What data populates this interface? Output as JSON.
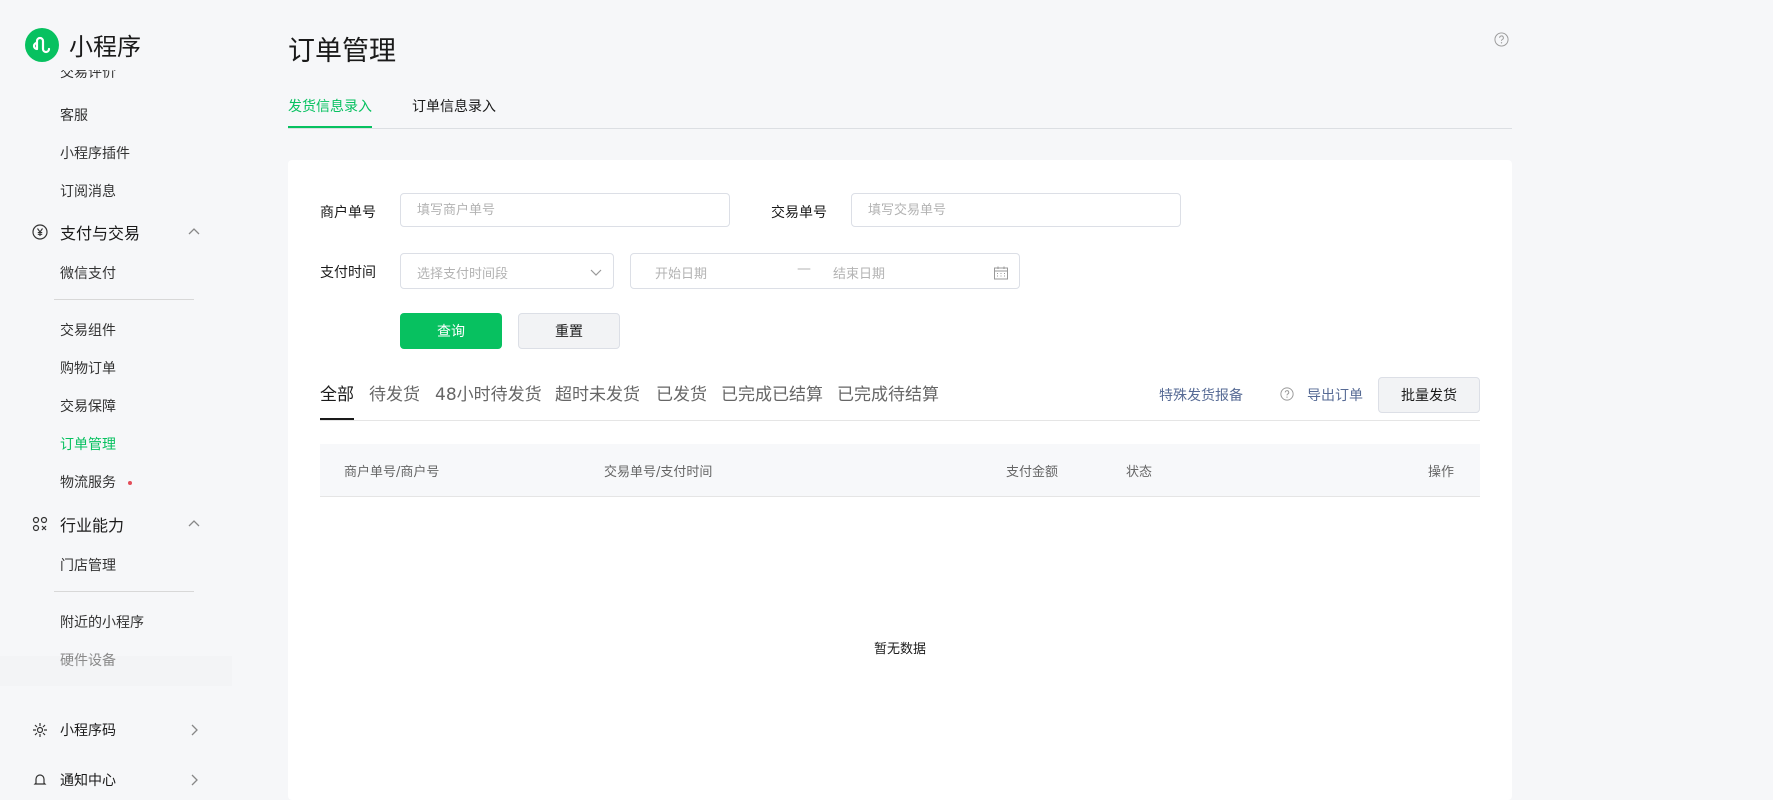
{
  "app": {
    "name": "小程序"
  },
  "sidebar": {
    "top_partial_item": "交易评价",
    "items_a": [
      "客服",
      "小程序插件",
      "订阅消息"
    ],
    "group_payment": "支付与交易",
    "items_b": [
      "微信支付"
    ],
    "items_c": [
      "交易组件",
      "购物订单",
      "交易保障",
      "订单管理",
      "物流服务"
    ],
    "group_industry": "行业能力",
    "items_d": [
      "门店管理"
    ],
    "items_e": [
      "附近的小程序",
      "硬件设备"
    ],
    "group_code": "小程序码",
    "group_notify_partial": "通知中心"
  },
  "page": {
    "title": "订单管理"
  },
  "tabs": [
    "发货信息录入",
    "订单信息录入"
  ],
  "filters": {
    "merchant_label": "商户单号",
    "merchant_placeholder": "填写商户单号",
    "trade_label": "交易单号",
    "trade_placeholder": "填写交易单号",
    "paytime_label": "支付时间",
    "paytime_placeholder": "选择支付时间段",
    "start_placeholder": "开始日期",
    "range_sep": "—",
    "end_placeholder": "结束日期"
  },
  "buttons": {
    "query": "查询",
    "reset": "重置",
    "batch_ship": "批量发货"
  },
  "status_tabs": [
    "全部",
    "待发货",
    "48小时待发货",
    "超时未发货",
    "已发货",
    "已完成已结算",
    "已完成待结算"
  ],
  "links": {
    "special_report": "特殊发货报备",
    "export": "导出订单"
  },
  "table": {
    "columns": [
      "商户单号/商户号",
      "交易单号/支付时间",
      "支付金额",
      "状态",
      "操作"
    ],
    "empty_text": "暂无数据"
  },
  "colors": {
    "brand": "#07c160",
    "link": "#576b95"
  }
}
